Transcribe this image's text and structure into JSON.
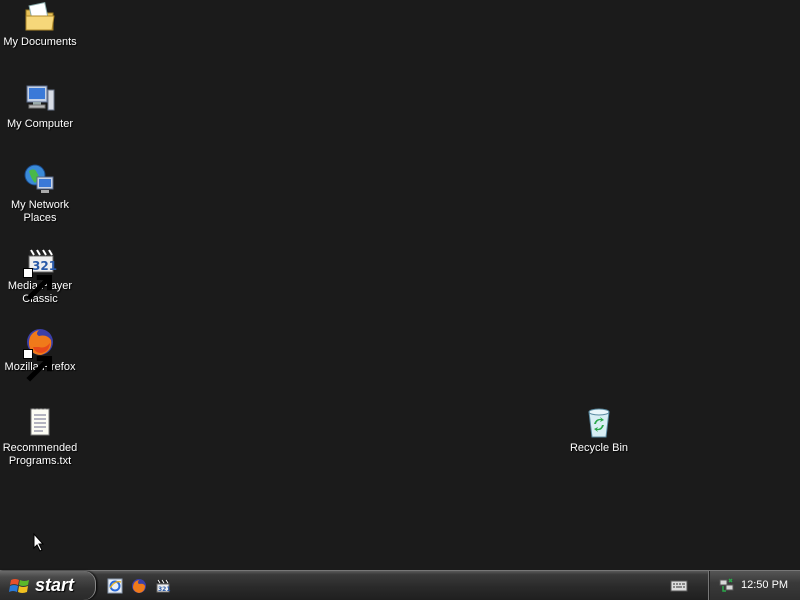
{
  "desktop": {
    "icons": [
      {
        "label": "My Documents",
        "icon": "my-documents-icon"
      },
      {
        "label": "My Computer",
        "icon": "my-computer-icon"
      },
      {
        "label": "My Network Places",
        "icon": "my-network-places-icon"
      },
      {
        "label": "Media Player Classic",
        "icon": "media-player-classic-icon"
      },
      {
        "label": "Mozilla Firefox",
        "icon": "firefox-icon"
      },
      {
        "label": "Recommended Programs.txt",
        "icon": "text-file-icon"
      },
      {
        "label": "Recycle Bin",
        "icon": "recycle-bin-icon"
      }
    ]
  },
  "taskbar": {
    "start_label": "start",
    "quick_launch": [
      "internet-explorer-icon",
      "firefox-icon",
      "media-player-classic-icon"
    ],
    "language_icon": "keyboard-icon",
    "tray_icon": "network-icon",
    "clock": "12:50 PM"
  },
  "colors": {
    "desktop_background": "#1b1b1b",
    "taskbar": "#2a2a2a",
    "label_text": "#ffffff"
  }
}
